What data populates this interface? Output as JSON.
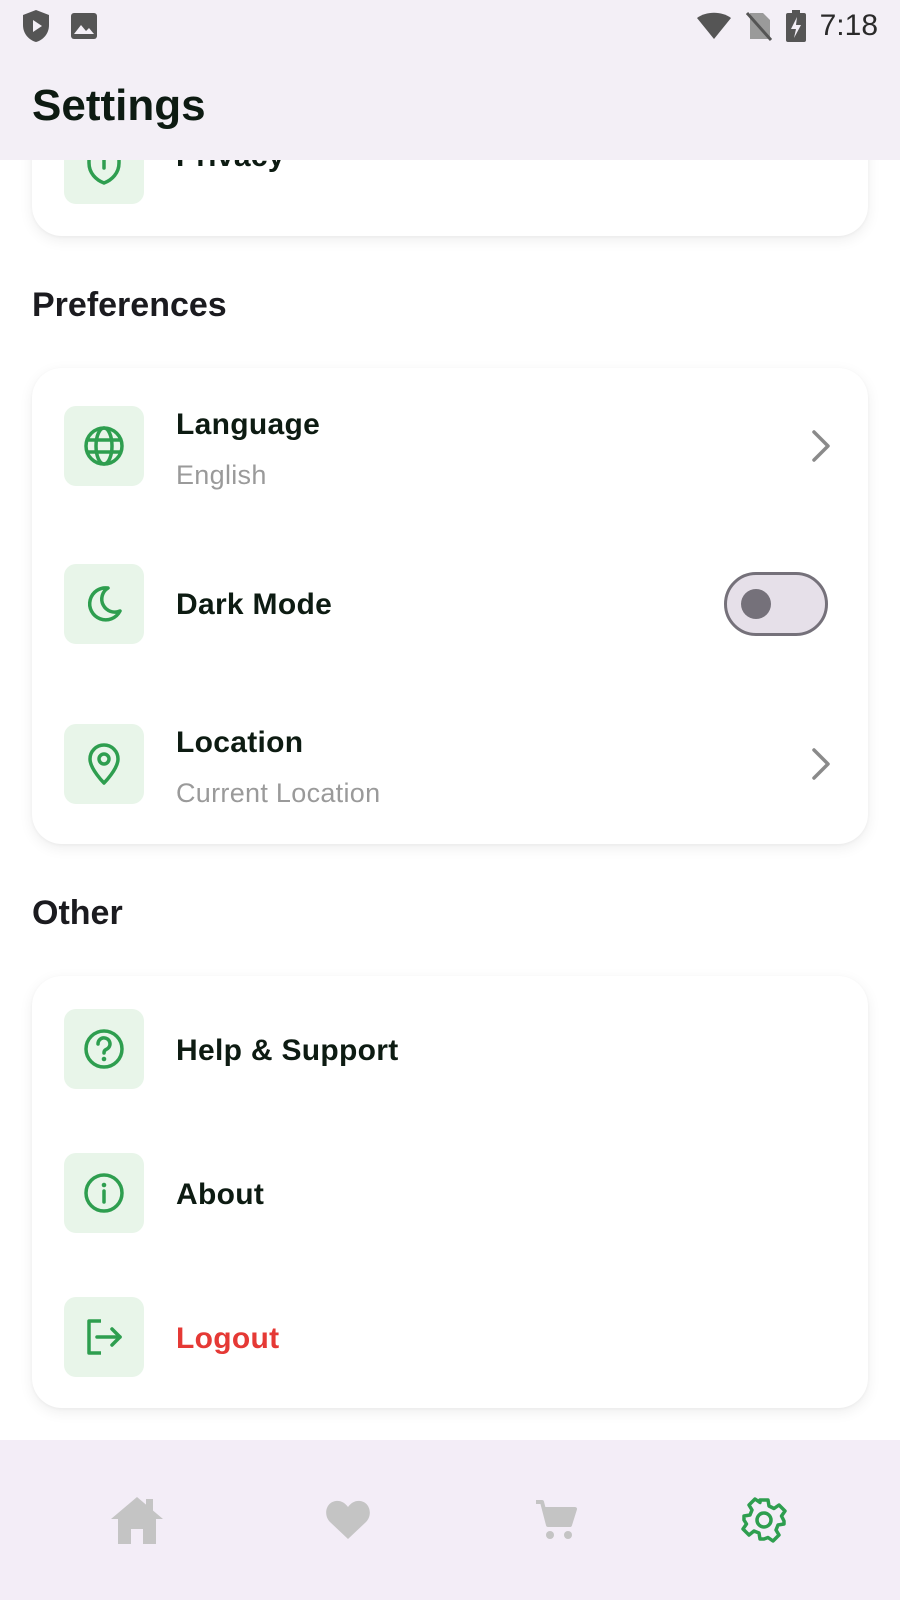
{
  "status_bar": {
    "time": "7:18",
    "left_icons": [
      "shield-play-icon",
      "image-icon"
    ],
    "right_icons": [
      "wifi-icon",
      "no-sim-icon",
      "battery-charging-icon"
    ]
  },
  "app_bar": {
    "title": "Settings"
  },
  "account_card": {
    "items": [
      {
        "label": "Privacy",
        "icon": "shield-icon"
      }
    ]
  },
  "preferences": {
    "heading": "Preferences",
    "items": [
      {
        "label": "Language",
        "value": "English",
        "icon": "globe-icon"
      },
      {
        "label": "Dark Mode",
        "icon": "moon-icon",
        "toggle_on": false
      },
      {
        "label": "Location",
        "value": "Current Location",
        "icon": "location-pin-icon"
      }
    ]
  },
  "other": {
    "heading": "Other",
    "items": [
      {
        "label": "Help & Support",
        "icon": "help-circle-icon"
      },
      {
        "label": "About",
        "icon": "info-icon"
      },
      {
        "label": "Logout",
        "icon": "logout-icon"
      }
    ]
  },
  "bottom_nav": {
    "items": [
      {
        "name": "home",
        "icon": "home-icon",
        "active": false
      },
      {
        "name": "favorites",
        "icon": "heart-icon",
        "active": false
      },
      {
        "name": "cart",
        "icon": "cart-icon",
        "active": false
      },
      {
        "name": "settings",
        "icon": "gear-icon",
        "active": true
      }
    ]
  },
  "colors": {
    "accent": "#2e9e4f",
    "icon_bg": "#e8f5e9",
    "logout": "#e53935",
    "bar_bg": "#f3eff6",
    "inactive_nav": "#c4c4c4"
  }
}
